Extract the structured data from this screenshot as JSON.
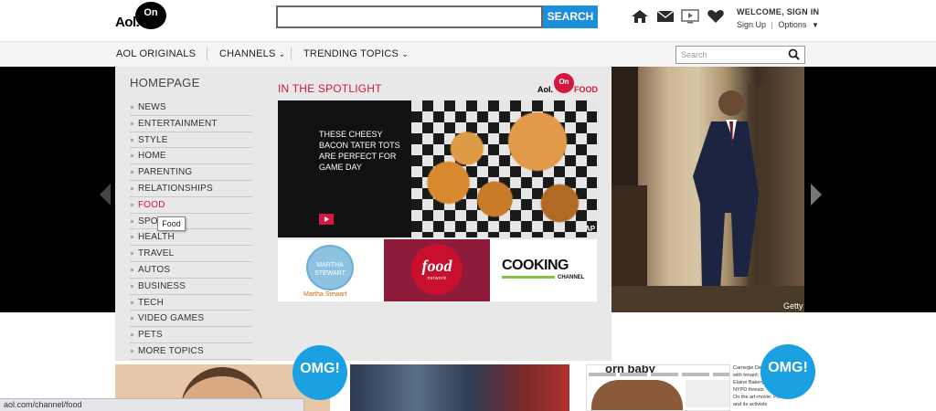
{
  "header": {
    "logo_text": "Aol.",
    "logo_circle": "On",
    "search_button": "SEARCH",
    "welcome": "WELCOME, SIGN IN",
    "signup": "Sign Up",
    "options": "Options"
  },
  "nav": {
    "items": [
      "AOL ORIGINALS",
      "CHANNELS",
      "TRENDING TOPICS"
    ],
    "search_placeholder": "Search"
  },
  "dropdown": {
    "heading": "HOMEPAGE",
    "menu": [
      "NEWS",
      "ENTERTAINMENT",
      "STYLE",
      "HOME",
      "PARENTING",
      "RELATIONSHIPS",
      "FOOD",
      "SPORTS",
      "HEALTH",
      "TRAVEL",
      "AUTOS",
      "BUSINESS",
      "TECH",
      "VIDEO GAMES",
      "PETS",
      "MORE TOPICS"
    ],
    "active_item": "FOOD",
    "tooltip": "Food",
    "spotlight_title": "IN THE SPOTLIGHT",
    "brand_aol": "Aol.",
    "brand_on": "On",
    "brand_food": "FOOD",
    "spotlight_caption": "THESE CHEESY BACON TATER TOTS ARE PERFECT FOR GAME DAY",
    "photo_credit": "AP",
    "partners": {
      "martha_circle": "MARTHA STEWART",
      "martha_label": "Martha Stewart",
      "food_logo": "food",
      "food_sub": "network",
      "cooking_logo": "COOKING",
      "cooking_sub": "CHANNEL"
    }
  },
  "hero": {
    "credit": "Getty"
  },
  "below": {
    "omg_label": "OMG!",
    "card3_title": "orn baby",
    "card4_text": [
      "Carnegie Deli serving",
      "with tenant; Sulla",
      "Elaine Bakery and",
      "NYPD threats",
      "On the art-movie: Pet shop",
      "and its activists"
    ]
  },
  "status": {
    "url": "aol.com/channel/food"
  },
  "colors": {
    "accent_red": "#d3173e",
    "search_blue": "#1d8ed8",
    "omg_blue": "#1ba0e2"
  }
}
